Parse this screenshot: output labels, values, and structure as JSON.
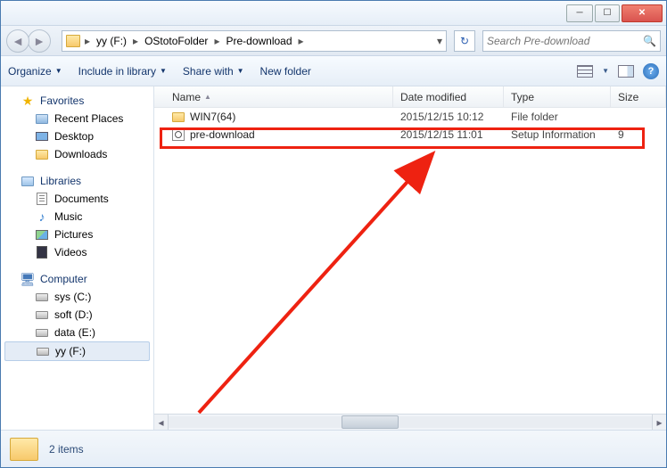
{
  "address": {
    "drive_label": "yy (F:)",
    "path1": "OStotoFolder",
    "path2": "Pre-download"
  },
  "search": {
    "placeholder": "Search Pre-download"
  },
  "toolbar": {
    "organize": "Organize",
    "include": "Include in library",
    "share": "Share with",
    "newfolder": "New folder"
  },
  "columns": {
    "name": "Name",
    "date": "Date modified",
    "type": "Type",
    "size": "Size"
  },
  "sidebar": {
    "favorites": "Favorites",
    "fav_items": {
      "recent": "Recent Places",
      "desktop": "Desktop",
      "downloads": "Downloads"
    },
    "libraries": "Libraries",
    "lib_items": {
      "documents": "Documents",
      "music": "Music",
      "pictures": "Pictures",
      "videos": "Videos"
    },
    "computer": "Computer",
    "drives": {
      "c": "sys (C:)",
      "d": "soft (D:)",
      "e": "data (E:)",
      "f": "yy (F:)"
    }
  },
  "files": [
    {
      "name": "WIN7(64)",
      "date": "2015/12/15 10:12",
      "type": "File folder",
      "size": ""
    },
    {
      "name": "pre-download",
      "date": "2015/12/15 11:01",
      "type": "Setup Information",
      "size": "9"
    }
  ],
  "status": {
    "count": "2 items"
  }
}
